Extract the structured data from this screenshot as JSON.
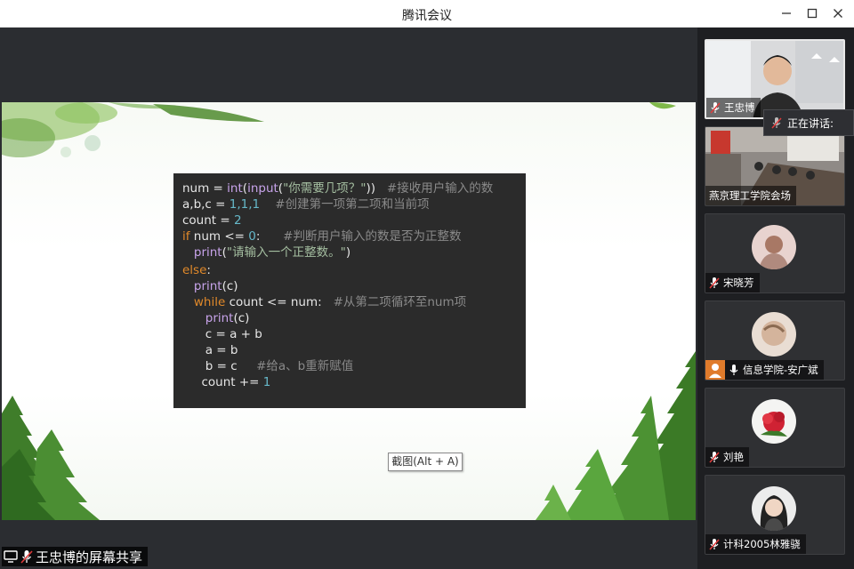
{
  "window": {
    "title": "腾讯会议"
  },
  "code": {
    "lines": [
      [
        {
          "t": "num = ",
          "c": "pl"
        },
        {
          "t": "int",
          "c": "fn"
        },
        {
          "t": "(",
          "c": "pl"
        },
        {
          "t": "input",
          "c": "fn"
        },
        {
          "t": "(",
          "c": "pl"
        },
        {
          "t": "\"你需要几项？\"",
          "c": "str"
        },
        {
          "t": "))   ",
          "c": "pl"
        },
        {
          "t": "#接收用户输入的数",
          "c": "cm"
        }
      ],
      [
        {
          "t": "a,b,c = ",
          "c": "pl"
        },
        {
          "t": "1,1,1",
          "c": "num"
        },
        {
          "t": "    ",
          "c": "pl"
        },
        {
          "t": "#创建第一项第二项和当前项",
          "c": "cm"
        }
      ],
      [
        {
          "t": "count = ",
          "c": "pl"
        },
        {
          "t": "2",
          "c": "num"
        }
      ],
      [
        {
          "t": "if",
          "c": "kw"
        },
        {
          "t": " num <= ",
          "c": "pl"
        },
        {
          "t": "0",
          "c": "num"
        },
        {
          "t": ":      ",
          "c": "pl"
        },
        {
          "t": "#判断用户输入的数是否为正整数",
          "c": "cm"
        }
      ],
      [
        {
          "t": "   ",
          "c": "pl"
        },
        {
          "t": "print",
          "c": "fn"
        },
        {
          "t": "(",
          "c": "pl"
        },
        {
          "t": "\"请输入一个正整数。\"",
          "c": "str"
        },
        {
          "t": ")",
          "c": "pl"
        }
      ],
      [
        {
          "t": "else",
          "c": "kw"
        },
        {
          "t": ":",
          "c": "pl"
        }
      ],
      [
        {
          "t": "   ",
          "c": "pl"
        },
        {
          "t": "print",
          "c": "fn"
        },
        {
          "t": "(c)",
          "c": "pl"
        }
      ],
      [
        {
          "t": "   ",
          "c": "pl"
        },
        {
          "t": "while",
          "c": "kw"
        },
        {
          "t": " count <= num:   ",
          "c": "pl"
        },
        {
          "t": "#从第二项循环至num项",
          "c": "cm"
        }
      ],
      [
        {
          "t": "      ",
          "c": "pl"
        },
        {
          "t": "print",
          "c": "fn"
        },
        {
          "t": "(c)",
          "c": "pl"
        }
      ],
      [
        {
          "t": "      c = a + b",
          "c": "pl"
        }
      ],
      [
        {
          "t": "      a = b",
          "c": "pl"
        }
      ],
      [
        {
          "t": "      b = c     ",
          "c": "pl"
        },
        {
          "t": "#给a、b重新赋值",
          "c": "cm"
        }
      ],
      [
        {
          "t": "     count += ",
          "c": "pl"
        },
        {
          "t": "1",
          "c": "num"
        }
      ]
    ]
  },
  "tooltip": "截图(Alt + A)",
  "share_label": "王忠博的屏幕共享",
  "speaking_label": "正在讲话:",
  "participants": [
    {
      "name": "王忠博",
      "mic_icon": "mic-muted-icon"
    },
    {
      "name": "燕京理工学院会场"
    },
    {
      "name": "宋晓芳",
      "mic_icon": "mic-muted-icon"
    },
    {
      "name": "信息学院-安广斌",
      "mic_icon": "mic-icon"
    },
    {
      "name": "刘艳",
      "mic_icon": "mic-muted-icon"
    },
    {
      "name": "计科2005林雅骁",
      "mic_icon": "mic-muted-icon"
    }
  ],
  "colors": {
    "accent_orange": "#e0892a",
    "panel_bg": "#1e1f22",
    "code_bg": "#2b2b2b"
  }
}
